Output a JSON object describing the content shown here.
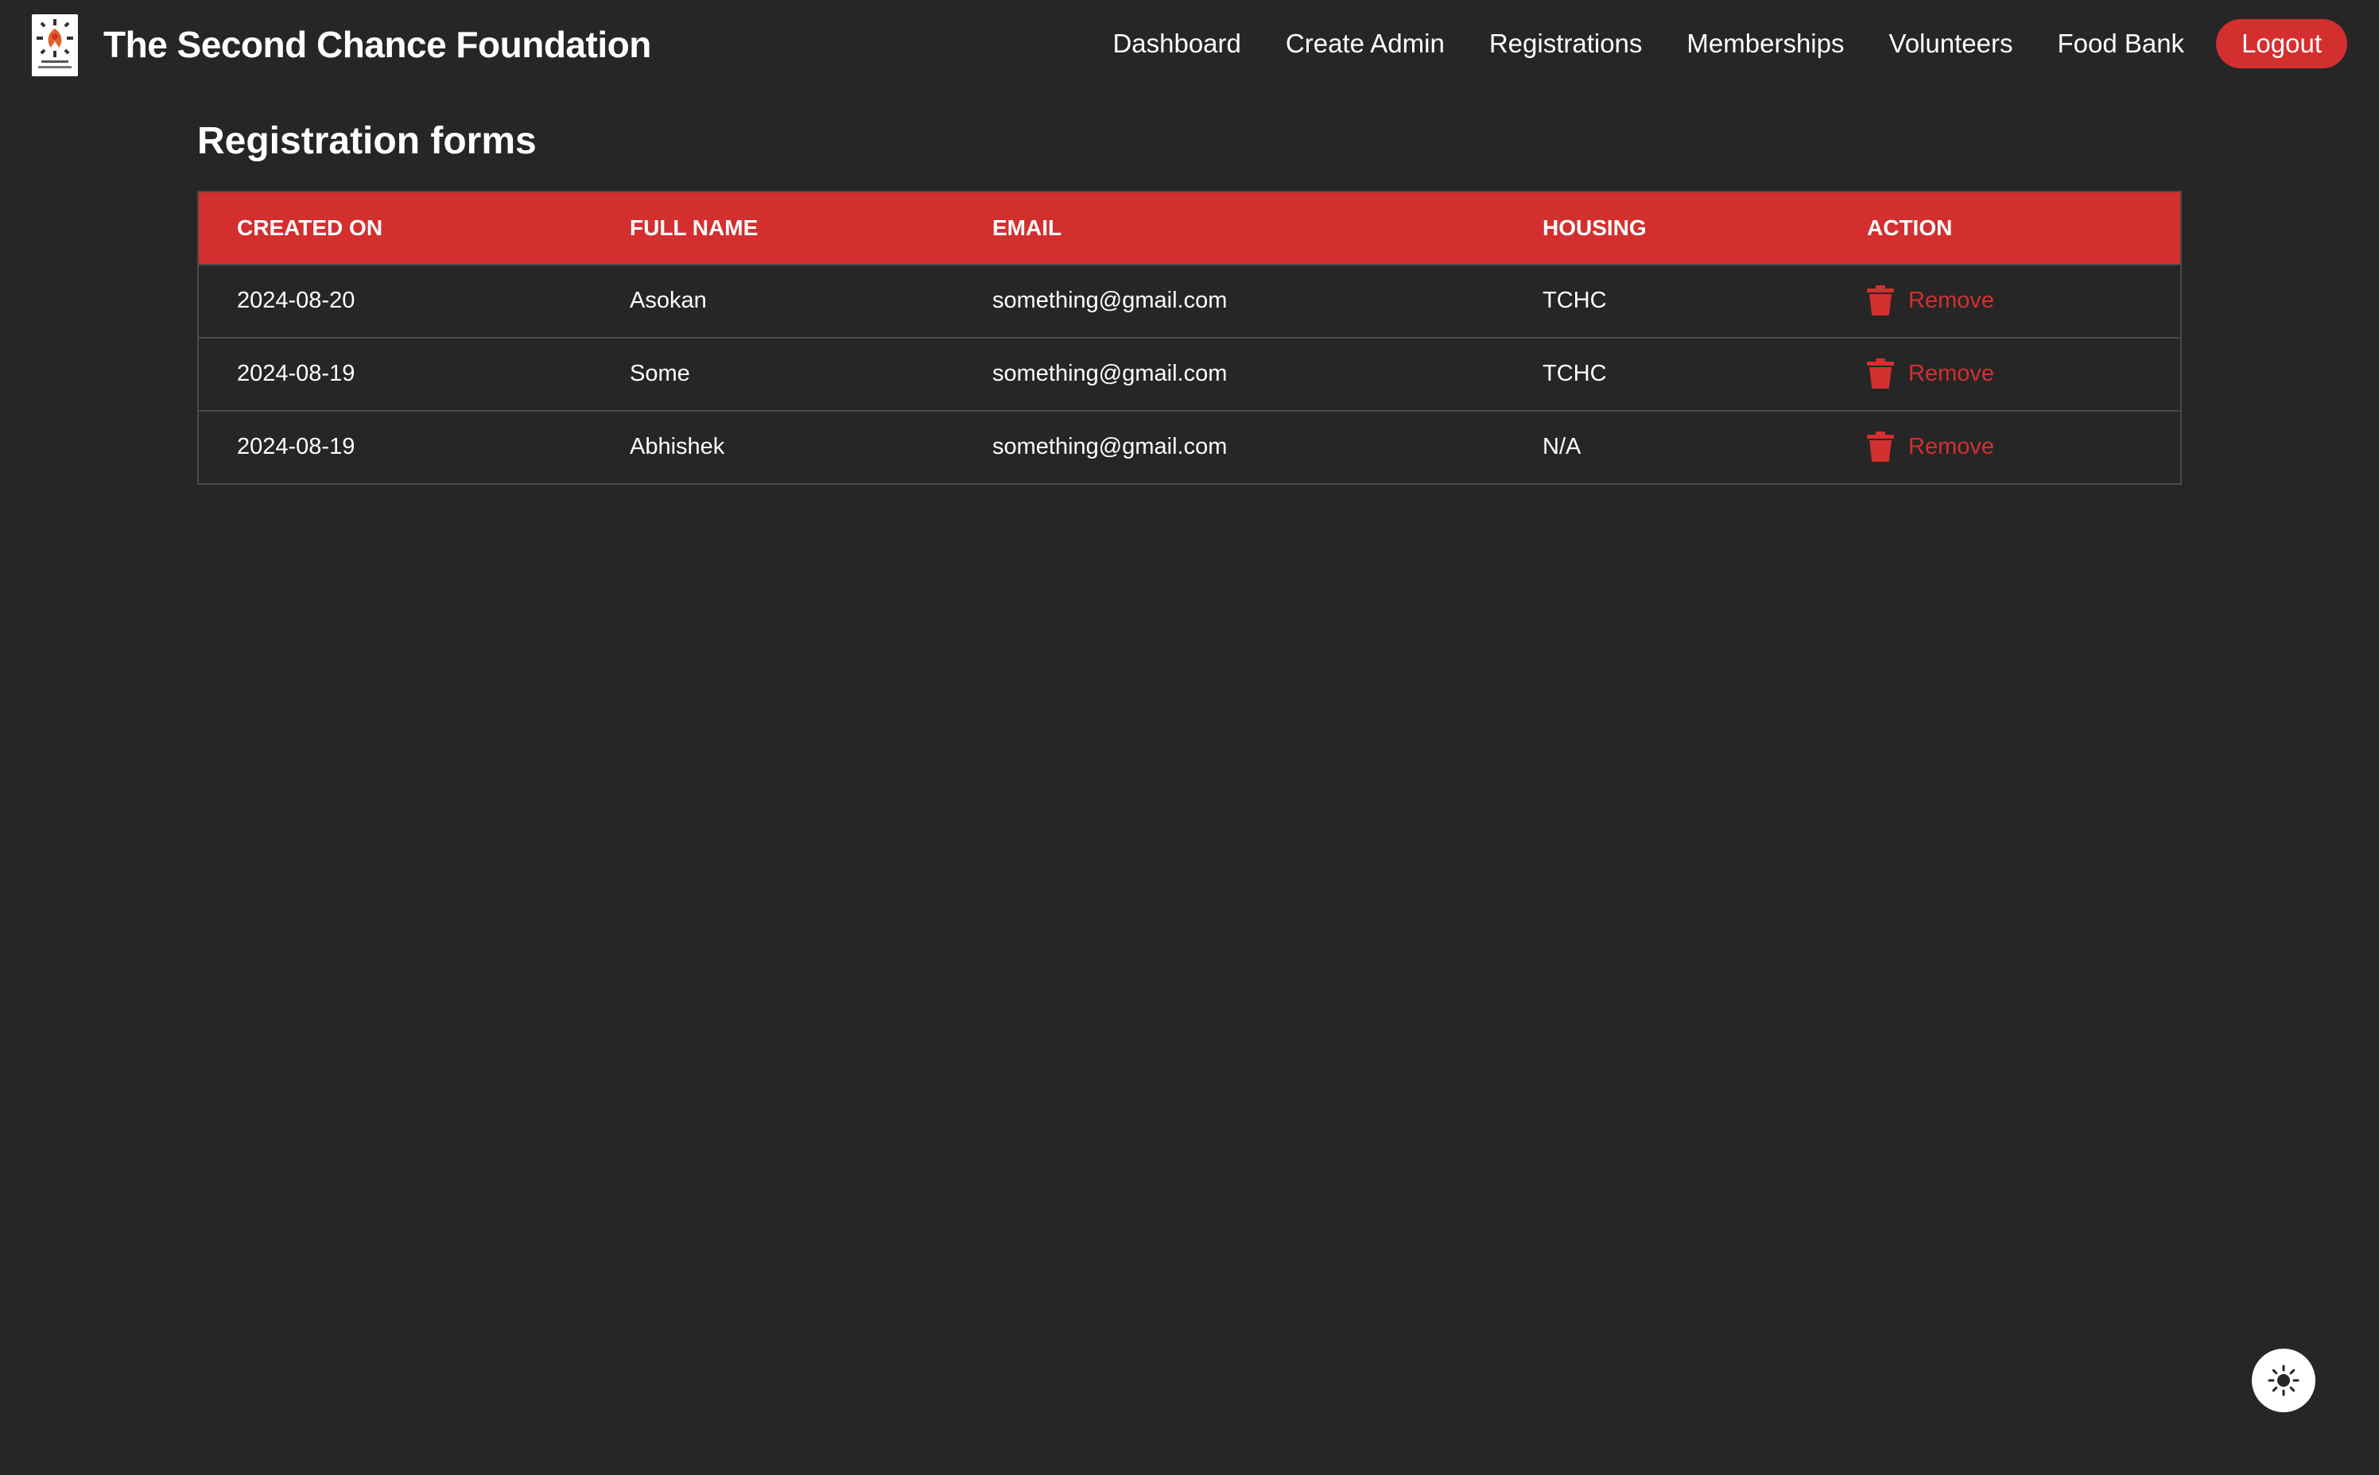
{
  "header": {
    "title": "The Second Chance Foundation",
    "logo_icon": "foundation-logo-icon"
  },
  "nav": {
    "links": [
      "Dashboard",
      "Create Admin",
      "Registrations",
      "Memberships",
      "Volunteers",
      "Food Bank"
    ],
    "logout_label": "Logout"
  },
  "main": {
    "heading": "Registration forms"
  },
  "table": {
    "columns": [
      "CREATED ON",
      "FULL NAME",
      "EMAIL",
      "HOUSING",
      "ACTION"
    ],
    "rows": [
      {
        "created_on": "2024-08-20",
        "full_name": "Asokan",
        "email": "something@gmail.com",
        "housing": "TCHC",
        "action": "Remove"
      },
      {
        "created_on": "2024-08-19",
        "full_name": "Some",
        "email": "something@gmail.com",
        "housing": "TCHC",
        "action": "Remove"
      },
      {
        "created_on": "2024-08-19",
        "full_name": "Abhishek",
        "email": "something@gmail.com",
        "housing": "N/A",
        "action": "Remove"
      }
    ]
  },
  "theme_toggle": {
    "icon": "sun-icon"
  },
  "colors": {
    "background": "#262626",
    "accent": "#d32f2f",
    "text": "#ffffff",
    "border": "#4a4a4a"
  }
}
